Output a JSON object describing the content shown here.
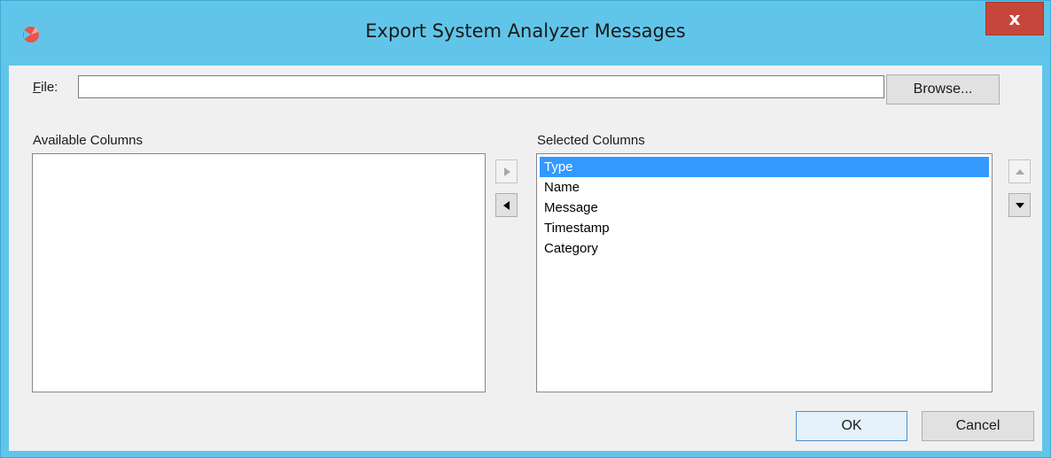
{
  "window": {
    "title": "Export System Analyzer Messages",
    "close_label": "x",
    "accent_color": "#61c5ea",
    "close_color": "#c7463c"
  },
  "file": {
    "label_mnemonic": "F",
    "label_rest": "ile:",
    "value": "",
    "browse_label": "Browse..."
  },
  "available_columns": {
    "label": "Available Columns",
    "items": []
  },
  "selected_columns": {
    "label": "Selected Columns",
    "items": [
      "Type",
      "Name",
      "Message",
      "Timestamp",
      "Category"
    ],
    "selected_index": 0
  },
  "buttons": {
    "add_icon": "triangle-right-icon",
    "remove_icon": "triangle-left-icon",
    "move_up_icon": "triangle-up-icon",
    "move_down_icon": "triangle-down-icon",
    "ok_label": "OK",
    "cancel_label": "Cancel"
  }
}
